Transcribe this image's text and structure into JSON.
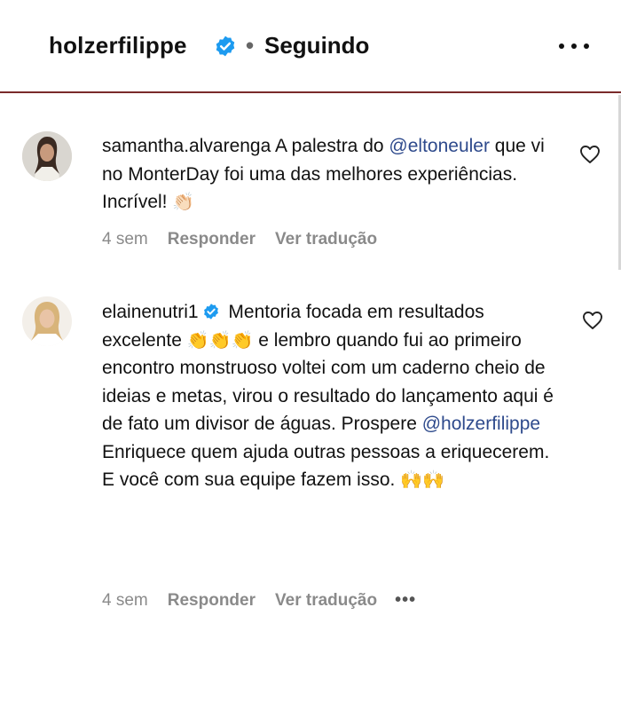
{
  "header": {
    "username": "holzerfilippe",
    "separator": "•",
    "follow_status": "Seguindo"
  },
  "comments": [
    {
      "author": "samantha.alvarenga",
      "text_before": " A palestra do ",
      "mention": "@eltoneuler",
      "text_after": " que vi no MonterDay foi uma das melhores experiências. Incrível! ",
      "emoji": "👏🏻",
      "time": "4 sem",
      "reply": "Responder",
      "translate": "Ver tradução"
    },
    {
      "author": "elainenutri1",
      "text_a": " Mentoria focada em resultados excelente ",
      "emoji_a": "👏👏👏",
      "text_b": " e lembro quando fui ao primeiro encontro monstruoso voltei com um caderno cheio de ideias e metas, virou o resultado do lançamento aqui é de fato um divisor de águas. Prospere ",
      "mention": "@holzerfilippe",
      "line3": "Enriquece quem ajuda outras pessoas a eriquecerem.",
      "line4": "E você com sua equipe fazem isso. ",
      "emoji_b": "🙌🙌",
      "time": "4 sem",
      "reply": "Responder",
      "translate": "Ver tradução",
      "more": "•••"
    }
  ],
  "icons": {
    "verified": "verified-badge-icon",
    "heart": "heart-icon",
    "more": "more-horizontal-icon"
  },
  "colors": {
    "verified_blue": "#1d9bf0",
    "mention": "#2e4a8c",
    "meta_gray": "#8a8a8a"
  }
}
